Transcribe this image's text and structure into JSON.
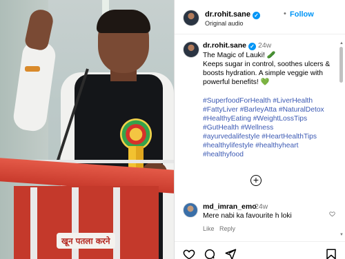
{
  "media": {
    "caption_text": "खून पतला करने"
  },
  "header": {
    "author": "dr.rohit.sane",
    "verified_mark": "✓",
    "dot": "•",
    "follow_label": "Follow",
    "audio_label": "Original audio"
  },
  "post_caption": {
    "author": "dr.rohit.sane",
    "verified_mark": "✓",
    "time": "24w",
    "lines": [
      "The Magic of Lauki! 🥒",
      "Keeps sugar in control, soothes ulcers &",
      "boosts hydration. A simple veggie with",
      "powerful benefits! 💚"
    ],
    "hashtag_lines": [
      "#SuperfoodForHealth #LiverHealth",
      "#FattyLiver #BarleyAtta #NaturalDetox",
      "#HealthyEating #WeightLossTips",
      "#GutHealth #Wellness",
      "#ayurvedalifestyle #HeartHealthTips",
      "#healthylifestyle #healthyheart",
      "#healthyfood"
    ]
  },
  "load_more": {
    "icon": "plus-circle-icon",
    "symbol": "+"
  },
  "comment": {
    "author": "md_imran_emo",
    "time": "24w",
    "text": "Mere nabi ka favourite h loki",
    "like_label": "Like",
    "reply_label": "Reply"
  },
  "actions": {
    "icons": [
      "heart-icon",
      "comment-icon",
      "share-icon",
      "bookmark-icon"
    ]
  },
  "scrollbar": {
    "up_arrow": "▲",
    "down_arrow": "▼"
  },
  "colors": {
    "link_blue": "#0095f6",
    "hashtag": "#3b59b3",
    "muted": "#737373"
  }
}
